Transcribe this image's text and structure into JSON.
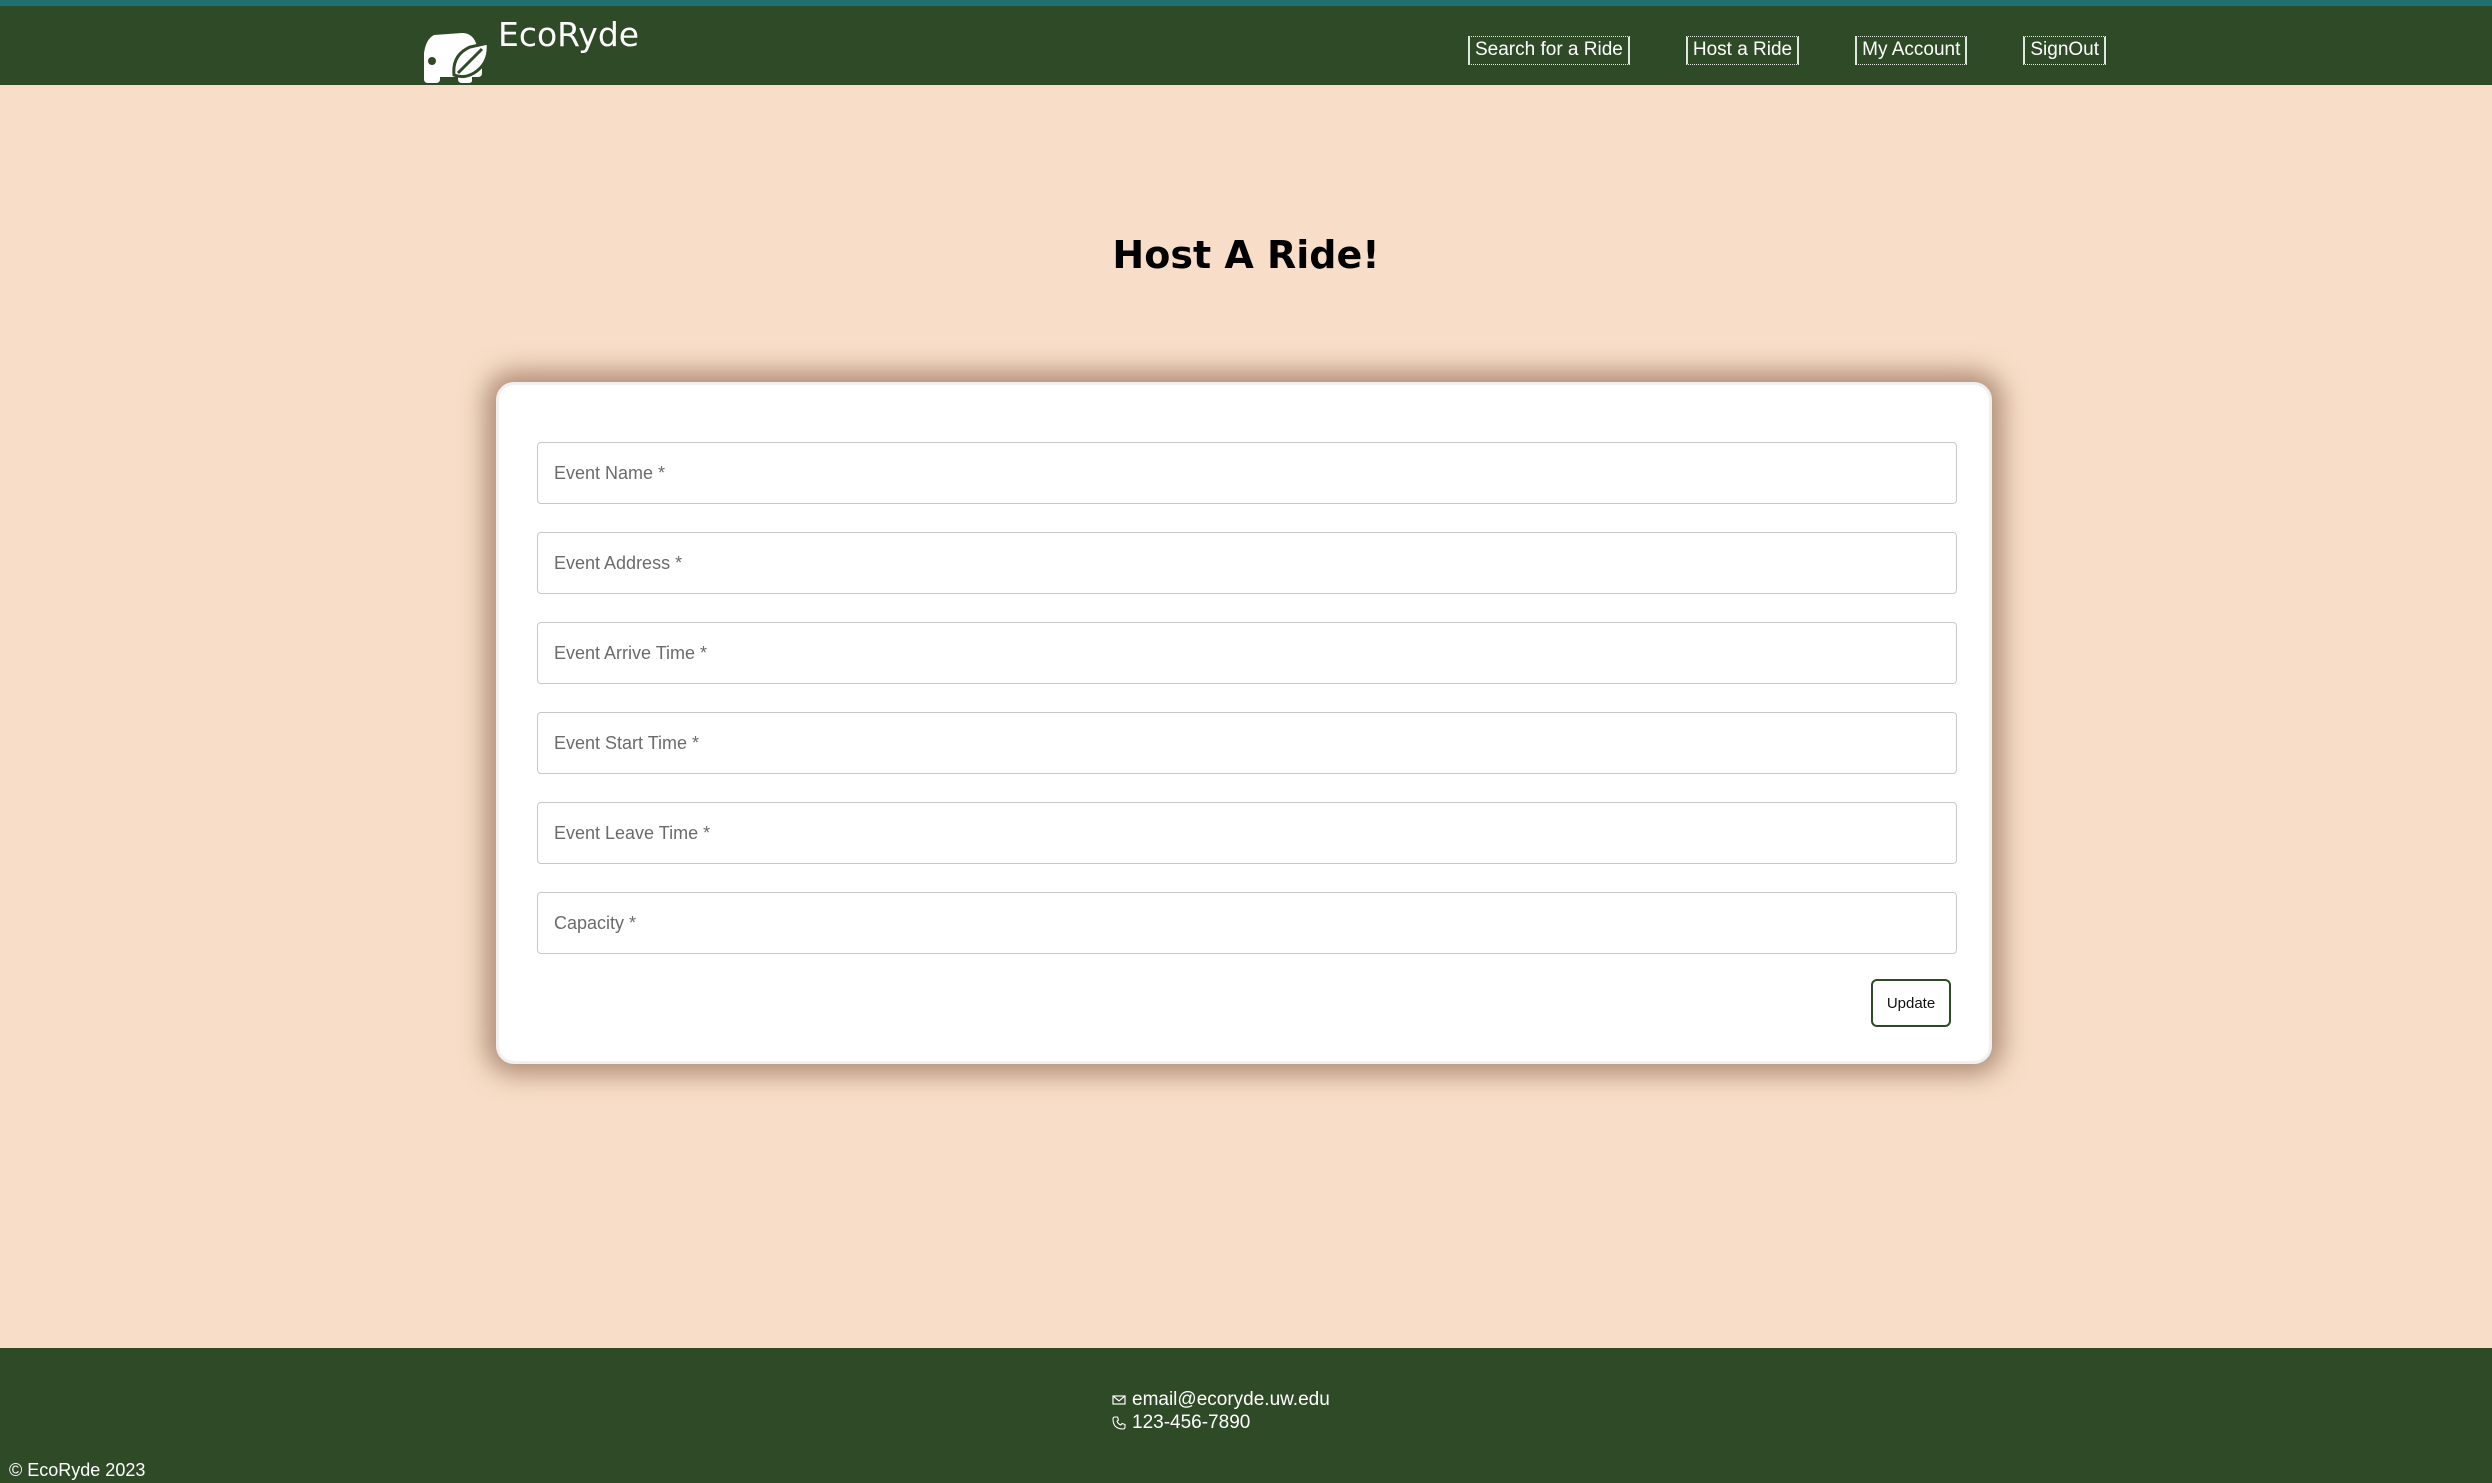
{
  "brand": {
    "name": "EcoRyde"
  },
  "nav": {
    "items": [
      {
        "label": "Search for a Ride"
      },
      {
        "label": "Host a Ride"
      },
      {
        "label": "My Account"
      },
      {
        "label": "SignOut"
      }
    ]
  },
  "page": {
    "title": "Host A Ride!"
  },
  "form": {
    "fields": [
      {
        "placeholder": "Event Name *",
        "value": ""
      },
      {
        "placeholder": "Event Address *",
        "value": ""
      },
      {
        "placeholder": "Event Arrive Time *",
        "value": ""
      },
      {
        "placeholder": "Event Start Time *",
        "value": ""
      },
      {
        "placeholder": "Event Leave Time *",
        "value": ""
      },
      {
        "placeholder": "Capacity *",
        "value": ""
      }
    ],
    "submit_label": "Update"
  },
  "footer": {
    "email": "email@ecoryde.uw.edu",
    "phone": "123-456-7890",
    "copyright": "© EcoRyde 2023",
    "email_icon": "envelope-icon",
    "phone_icon": "phone-icon"
  },
  "colors": {
    "navbar": "#2f4a26",
    "background": "#f8dec8",
    "card": "#ffffff",
    "topline": "#1f6f73"
  }
}
